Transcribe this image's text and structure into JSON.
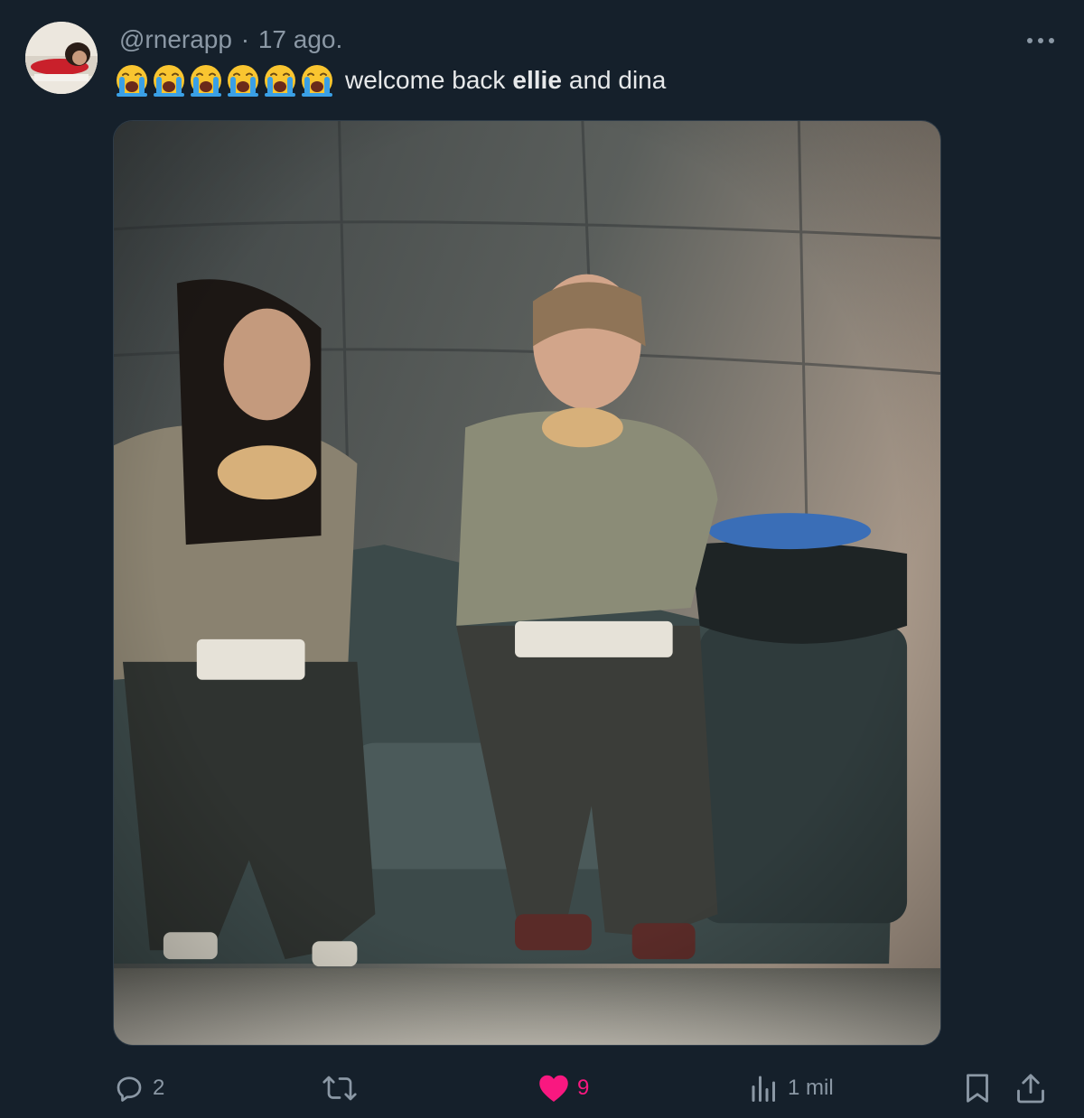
{
  "tweet": {
    "handle": "@rnerapp",
    "separator": "·",
    "timestamp": "17 ago.",
    "text_before": "welcome back",
    "text_bold": "ellie",
    "text_after": "and dina",
    "emoji_count": 6,
    "emoji_name": "loudly-crying-face-icon"
  },
  "actions": {
    "replies": "2",
    "retweets": "",
    "likes": "9",
    "views": "1 mil"
  },
  "colors": {
    "background": "#15202b",
    "text": "#e7e9ea",
    "secondary_text": "#8b98a5",
    "like_active": "#f91880"
  },
  "icons": {
    "more": "more-horizontal-icon",
    "reply": "reply-icon",
    "retweet": "retweet-icon",
    "like": "heart-filled-icon",
    "views": "views-chart-icon",
    "bookmark": "bookmark-icon",
    "share": "share-icon"
  }
}
